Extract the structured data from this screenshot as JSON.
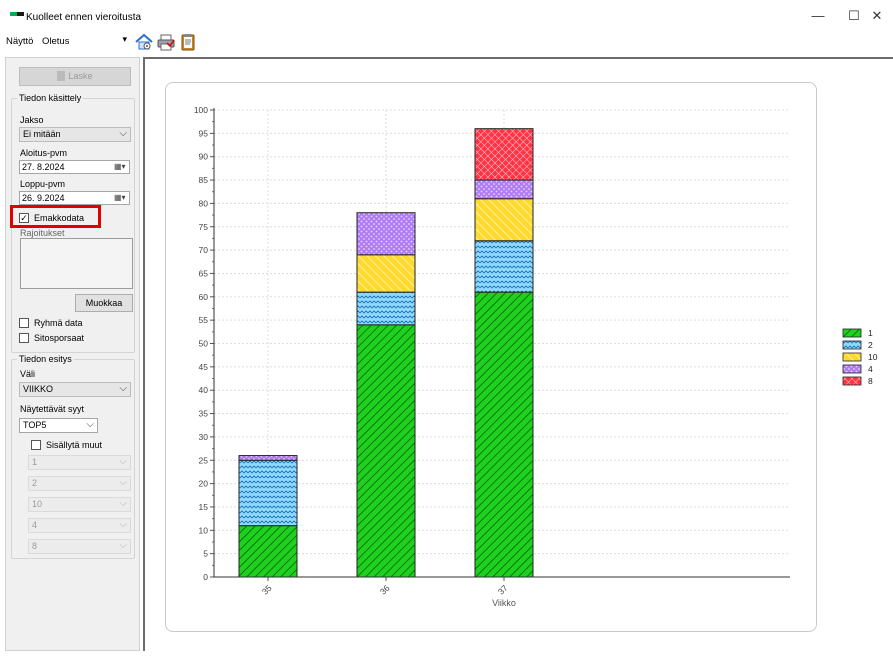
{
  "window": {
    "title": "Kuolleet ennen vieroitusta",
    "logo_colors": [
      "#00b050",
      "#1a1a1a"
    ],
    "minimize": "—",
    "maximize": "☐",
    "close": "✕"
  },
  "toolbar": {
    "nayto_label": "Näyttö",
    "nayto_value": "Oletus",
    "icons": [
      "settings-house-icon",
      "print-icon",
      "clipboard-icon"
    ]
  },
  "left": {
    "laske_label": "Laske",
    "tiedon_kasittely": "Tiedon käsittely",
    "jakso_label": "Jakso",
    "jakso_value": "Ei mitään",
    "aloitus_label": "Aloitus-pvm",
    "aloitus_value": "27.  8.2024",
    "loppu_label": "Loppu-pvm",
    "loppu_value": "26.  9.2024",
    "emakkodata_label": "Emakkodata",
    "emakkodata_checked": true,
    "rajoitukset_label": "Rajoitukset",
    "muokkaa_label": "Muokkaa",
    "ryhma_label": "Ryhmä data",
    "ryhma_checked": false,
    "sitosporsaat_label": "Sitosporsaat",
    "sitosporsaat_checked": false,
    "tiedon_esitys": "Tiedon esitys",
    "vali_label": "Väli",
    "vali_value": "VIIKKO",
    "syyt_label": "Näytettävät syyt",
    "syyt_value": "TOP5",
    "sisallyta_label": "Sisällytä muut",
    "sisallyta_checked": false,
    "cause_selects": [
      "1",
      "2",
      "10",
      "4",
      "8"
    ]
  },
  "chart_data": {
    "type": "bar",
    "stacked": true,
    "categories": [
      "35",
      "36",
      "37"
    ],
    "xlabel": "Viikko",
    "ylabel": "",
    "ylim": [
      0,
      100
    ],
    "ytick_step": 5,
    "grid": true,
    "legend_position": "right",
    "series": [
      {
        "name": "1",
        "values": [
          11,
          54,
          61
        ],
        "color": "#1fd11f",
        "pattern": "diagonal-down"
      },
      {
        "name": "2",
        "values": [
          14,
          7,
          11
        ],
        "color": "#7fd3ff",
        "pattern": "zigzag"
      },
      {
        "name": "10",
        "values": [
          0,
          8,
          9
        ],
        "color": "#ffd92e",
        "pattern": "diagonal-up"
      },
      {
        "name": "4",
        "values": [
          1,
          9,
          4
        ],
        "color": "#b07cf5",
        "pattern": "dots"
      },
      {
        "name": "8",
        "values": [
          0,
          0,
          11
        ],
        "color": "#ff3344",
        "pattern": "crosshatch"
      }
    ]
  }
}
